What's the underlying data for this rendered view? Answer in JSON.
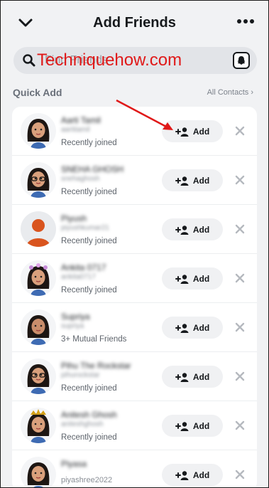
{
  "header": {
    "title": "Add Friends"
  },
  "search": {
    "placeholder": "Find Friends"
  },
  "watermark": "Techniquehow.com",
  "section": {
    "title": "Quick Add",
    "all_contacts": "All Contacts"
  },
  "add_label": "Add",
  "suggestions": [
    {
      "name": "Aarti Tamil",
      "username": "aartitamil",
      "subtitle": "Recently joined",
      "avatar": "bitmoji-woman-dark-hair"
    },
    {
      "name": "SNEHA GHOSH",
      "username": "snehaghosh",
      "subtitle": "Recently joined",
      "avatar": "bitmoji-woman-glasses"
    },
    {
      "name": "Piyush",
      "username": "piyushkumar21",
      "subtitle": "Recently joined",
      "avatar": "default-silhouette"
    },
    {
      "name": "Ankita 0717",
      "username": "ankita0717",
      "subtitle": "Recently joined",
      "avatar": "bitmoji-woman-flower-crown"
    },
    {
      "name": "Supriya",
      "username": "supriya",
      "subtitle": "3+ Mutual Friends",
      "avatar": "bitmoji-woman-brown-hair"
    },
    {
      "name": "Pihu The Rockstar",
      "username": "pihurockstar",
      "subtitle": "Recently joined",
      "avatar": "bitmoji-woman-glasses-2"
    },
    {
      "name": "Anitesh Ghosh",
      "username": "aniteshghosh",
      "subtitle": "Recently joined",
      "avatar": "bitmoji-woman-crown"
    },
    {
      "name": "Piyasa",
      "username": "piyashree2022",
      "subtitle": "",
      "avatar": "bitmoji-woman-dark-hair-2"
    }
  ],
  "colors": {
    "accent": "#e01919",
    "background": "#f1f2f4",
    "card": "#ffffff",
    "button": "#f0f1f3"
  }
}
